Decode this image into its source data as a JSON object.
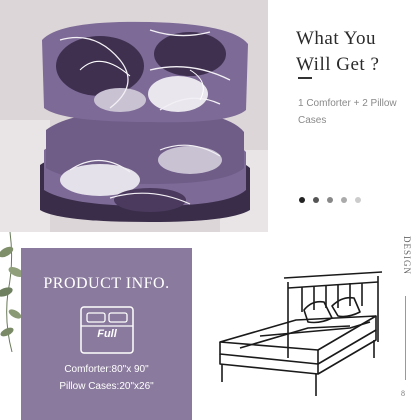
{
  "hero": {
    "headline_line1": "What You",
    "headline_line2": "Will Get ?",
    "subtitle": "1 Comforter + 2 Pillow Cases",
    "carousel_dot_colors": [
      "#222222",
      "#555555",
      "#888888",
      "#aaaaaa",
      "#cccccc"
    ]
  },
  "info_card": {
    "title": "PRODUCT INFO.",
    "bed_size": "Full",
    "comforter_spec": "Comforter:80\"x 90\"",
    "pillow_spec": "Pillow Cases:20\"x26\""
  },
  "side": {
    "vertical_label": "DESIGN",
    "page_number": "8"
  },
  "colors": {
    "card_purple": "#8a7a9d",
    "bedding_purple": "#7d6a96",
    "bedding_dark": "#3f3050",
    "bedding_light": "#c9c2d3"
  },
  "icons": [
    "bed-outline-icon",
    "bed-line-drawing",
    "plant-decoration"
  ]
}
